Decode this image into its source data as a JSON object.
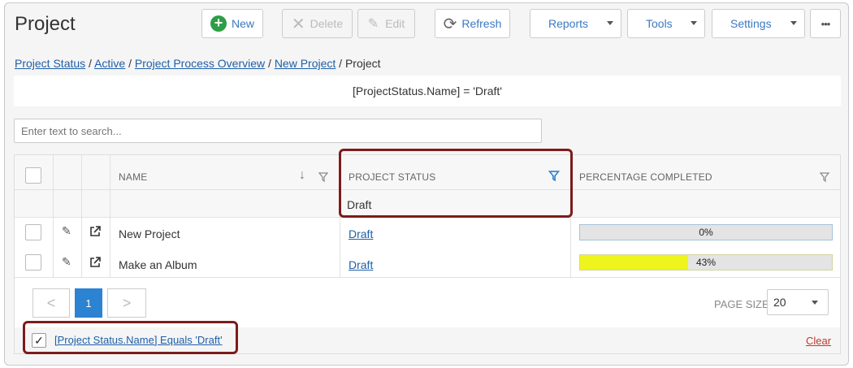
{
  "app": {
    "title": "Project"
  },
  "toolbar": {
    "new_label": "New",
    "delete_label": "Delete",
    "edit_label": "Edit",
    "refresh_label": "Refresh",
    "reports_label": "Reports",
    "tools_label": "Tools",
    "settings_label": "Settings",
    "more_label": "•••"
  },
  "breadcrumb": {
    "items": [
      "Project Status",
      "Active",
      "Project Process Overview",
      "New Project"
    ],
    "current": "Project",
    "separator": "/"
  },
  "criteria": {
    "text": "[ProjectStatus.Name] = 'Draft'"
  },
  "search": {
    "placeholder": "Enter text to search..."
  },
  "grid": {
    "columns": {
      "name": "NAME",
      "status": "PROJECT STATUS",
      "percent": "PERCENTAGE COMPLETED"
    },
    "status_filter_value": "Draft",
    "rows": [
      {
        "name": "New Project",
        "status": "Draft",
        "percent_label": "0%",
        "percent": 0
      },
      {
        "name": "Make an Album",
        "status": "Draft",
        "percent_label": "43%",
        "percent": 43
      }
    ]
  },
  "pager": {
    "prev": "<",
    "page": "1",
    "next": ">",
    "page_size_label": "PAGE SIZE",
    "page_size": "20"
  },
  "filter": {
    "text": "[Project Status.Name] Equals 'Draft'",
    "clear_label": "Clear",
    "checked": "✓"
  },
  "colors": {
    "accent": "#2b83d1",
    "link": "#1f5fa8",
    "progress_fill": "#eef51c",
    "highlight_box": "#7d1b1b",
    "clear_red": "#c0392b",
    "new_icon": "#2e9e46"
  }
}
